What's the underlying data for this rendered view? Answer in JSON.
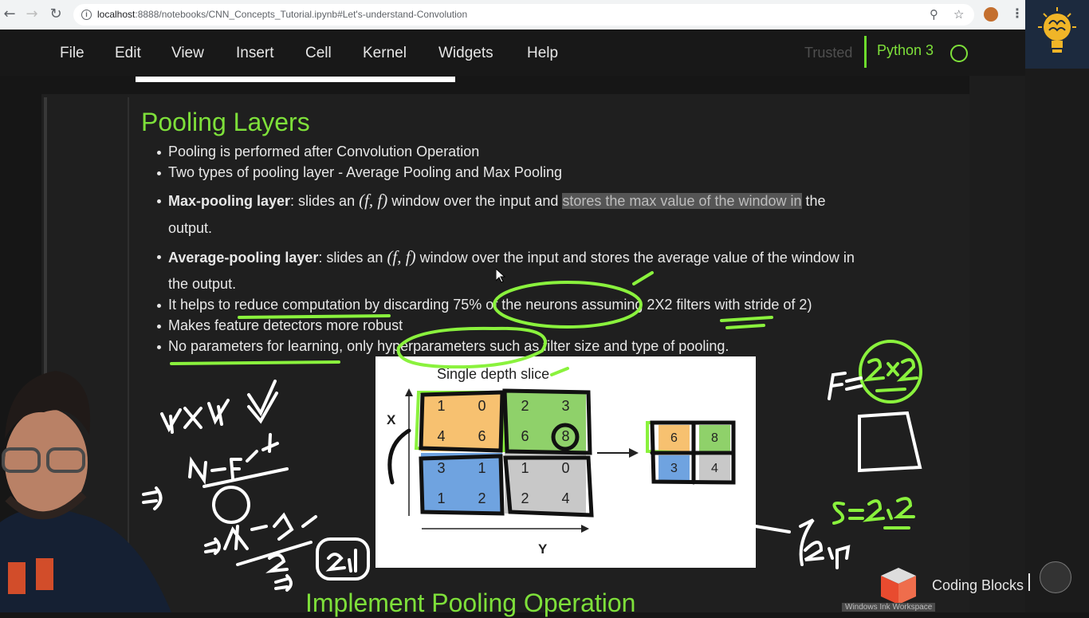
{
  "browser": {
    "url_host": "localhost",
    "url_rest": ":8888/notebooks/CNN_Concepts_Tutorial.ipynb#Let's-understand-Convolution"
  },
  "menubar": {
    "items": [
      "File",
      "Edit",
      "View",
      "Insert",
      "Cell",
      "Kernel",
      "Widgets",
      "Help"
    ],
    "trusted_label": "Trusted",
    "kernel_name": "Python 3"
  },
  "content": {
    "heading": "Pooling Layers",
    "bullets": {
      "b1": "Pooling is performed after Convolution Operation",
      "b2": "Two types of pooling layer - Average Pooling and Max Pooling",
      "b3_bold": "Max-pooling layer",
      "b3_pre": ": slides an ",
      "b3_math": "(f, f)",
      "b3_mid": " window over the input and ",
      "b3_highlight": "stores the max value of the window in",
      "b3_post": " the",
      "b3_line2": "output.",
      "b4_bold": "Average-pooling layer",
      "b4_pre": ": slides an ",
      "b4_math": "(f, f)",
      "b4_post": " window over the input and stores the average value of the window in",
      "b4_line2": "the output.",
      "b5": "It helps to reduce computation by discarding 75% of the neurons assuming 2X2 filters with stride of 2)",
      "b6": "Makes feature detectors more robust",
      "b7": "No parameters for learning, only hyperparameters such as filter size and type of pooling."
    },
    "next_heading": "Implement Pooling Operation"
  },
  "figure": {
    "title": "Single depth slice",
    "x_label": "X",
    "y_label": "Y",
    "input_grid": [
      [
        1,
        0,
        2,
        3
      ],
      [
        4,
        6,
        6,
        8
      ],
      [
        3,
        1,
        1,
        0
      ],
      [
        1,
        2,
        2,
        4
      ]
    ],
    "output_grid": [
      [
        6,
        8
      ],
      [
        3,
        4
      ]
    ],
    "colors": {
      "orange": "#f7c170",
      "green": "#8fd16a",
      "blue": "#6fa3e0",
      "gray": "#c8c8c8"
    }
  },
  "annotations": {
    "formula_1": "4x4",
    "formula_2": "N-F",
    "formula_3": "+1",
    "formula_4": "S",
    "formula_5": "4-2+1",
    "formula_6": "2",
    "formula_7": "2,2",
    "filter_size": "F=2x2",
    "stride": "S=2,2",
    "result": "2,2"
  },
  "branding": {
    "channel": "Coding Blocks",
    "watermark": "Windows Ink Workspace"
  }
}
